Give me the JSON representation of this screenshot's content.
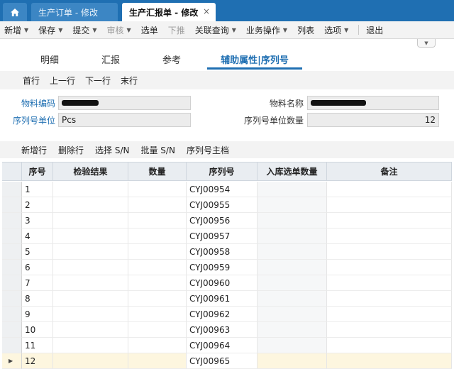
{
  "tabs": {
    "home_icon": "home-icon",
    "items": [
      {
        "label": "生产订单 - 修改",
        "active": false
      },
      {
        "label": "生产汇报单 - 修改",
        "active": true
      }
    ],
    "close_glyph": "×"
  },
  "toolbar": {
    "items": [
      {
        "label": "新增",
        "dropdown": true,
        "disabled": false
      },
      {
        "label": "保存",
        "dropdown": true,
        "disabled": false
      },
      {
        "label": "提交",
        "dropdown": true,
        "disabled": false
      },
      {
        "label": "审核",
        "dropdown": true,
        "disabled": true
      },
      {
        "label": "选单",
        "dropdown": false,
        "disabled": false
      },
      {
        "label": "下推",
        "dropdown": false,
        "disabled": true
      },
      {
        "label": "关联查询",
        "dropdown": true,
        "disabled": false
      },
      {
        "label": "业务操作",
        "dropdown": true,
        "disabled": false
      },
      {
        "label": "列表",
        "dropdown": false,
        "disabled": false
      },
      {
        "label": "选项",
        "dropdown": true,
        "disabled": false
      },
      {
        "label": "退出",
        "dropdown": false,
        "disabled": false
      }
    ]
  },
  "subtabs": [
    "明细",
    "汇报",
    "参考",
    "辅助属性|序列号"
  ],
  "nav": [
    "首行",
    "上一行",
    "下一行",
    "末行"
  ],
  "form": {
    "material_code_label": "物料编码",
    "material_name_label": "物料名称",
    "serial_unit_label": "序列号单位",
    "serial_unit_value": "Pcs",
    "serial_unit_qty_label": "序列号单位数量",
    "serial_unit_qty_value": "12"
  },
  "grid_toolbar": [
    "新增行",
    "删除行",
    "选择 S/N",
    "批量 S/N",
    "序列号主档"
  ],
  "grid": {
    "columns": [
      "序号",
      "检验结果",
      "数量",
      "序列号",
      "入库选单数量",
      "备注"
    ],
    "rows": [
      {
        "no": "1",
        "serial": "CYJ00954"
      },
      {
        "no": "2",
        "serial": "CYJ00955"
      },
      {
        "no": "3",
        "serial": "CYJ00956"
      },
      {
        "no": "4",
        "serial": "CYJ00957"
      },
      {
        "no": "5",
        "serial": "CYJ00958"
      },
      {
        "no": "6",
        "serial": "CYJ00959"
      },
      {
        "no": "7",
        "serial": "CYJ00960"
      },
      {
        "no": "8",
        "serial": "CYJ00961"
      },
      {
        "no": "9",
        "serial": "CYJ00962"
      },
      {
        "no": "10",
        "serial": "CYJ00963"
      },
      {
        "no": "11",
        "serial": "CYJ00964"
      },
      {
        "no": "12",
        "serial": "CYJ00965"
      }
    ],
    "current_row_marker": "▶"
  },
  "colors": {
    "tabbar": "#1f6fb2",
    "accent": "#1f6fb2",
    "current_row": "#fdf6df"
  }
}
